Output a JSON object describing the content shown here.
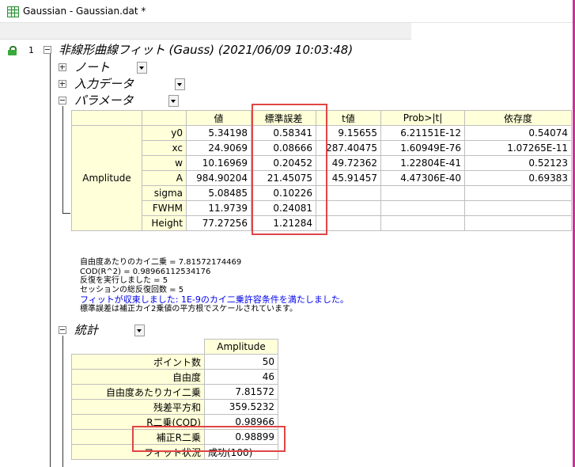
{
  "window": {
    "title": "Gaussian - Gaussian.dat *"
  },
  "report": {
    "row_number": "1",
    "title": "非線形曲線フィット (Gauss) (2021/06/09 10:03:48)",
    "sections": {
      "notes": "ノート",
      "input_data": "入力データ",
      "parameters": "パラメータ",
      "statistics": "統計"
    }
  },
  "params": {
    "headers": [
      "値",
      "標準誤差",
      "t値",
      "Prob>|t|",
      "依存度"
    ],
    "group_label": "Amplitude",
    "rows": [
      {
        "name": "y0",
        "value": "5.34198",
        "error": "0.58341",
        "t": "9.15655",
        "prob": "6.21151E-12",
        "dep": "0.54074"
      },
      {
        "name": "xc",
        "value": "24.9069",
        "error": "0.08666",
        "t": "287.40475",
        "prob": "1.60949E-76",
        "dep": "1.07265E-11"
      },
      {
        "name": "w",
        "value": "10.16969",
        "error": "0.20452",
        "t": "49.72362",
        "prob": "1.22804E-41",
        "dep": "0.52123"
      },
      {
        "name": "A",
        "value": "984.90204",
        "error": "21.45075",
        "t": "45.91457",
        "prob": "4.47306E-40",
        "dep": "0.69383"
      },
      {
        "name": "sigma",
        "value": "5.08485",
        "error": "0.10226",
        "t": "",
        "prob": "",
        "dep": ""
      },
      {
        "name": "FWHM",
        "value": "11.9739",
        "error": "0.24081",
        "t": "",
        "prob": "",
        "dep": ""
      },
      {
        "name": "Height",
        "value": "77.27256",
        "error": "1.21284",
        "t": "",
        "prob": "",
        "dep": ""
      }
    ]
  },
  "notes": {
    "lines": [
      "自由度あたりのカイ二乗 = 7.81572174469",
      "COD(R^2) = 0.98966112534176",
      "反復を実行しました = 5",
      "セッションの総反復回数 = 5"
    ],
    "converged": "フィットが収束しました: 1E-9のカイ二乗許容条件を満たしました。",
    "scale_note": "標準誤差は補正カイ2乗値の平方根でスケールされています。"
  },
  "stats": {
    "header": "Amplitude",
    "rows": [
      {
        "label": "ポイント数",
        "value": "50"
      },
      {
        "label": "自由度",
        "value": "46"
      },
      {
        "label": "自由度あたりカイ二乗",
        "value": "7.81572"
      },
      {
        "label": "残差平方和",
        "value": "359.5232"
      },
      {
        "label": "R二乗(COD)",
        "value": "0.98966"
      },
      {
        "label": "補正R二乗",
        "value": "0.98899"
      },
      {
        "label": "フィット状況",
        "value": "成功(100)"
      }
    ]
  },
  "colors": {
    "header_fill": "#ffffd9",
    "highlight": "#e04545",
    "converged_text": "#0000ee"
  },
  "icons": [
    "lock-icon",
    "expander-icon",
    "dropdown-arrow-icon",
    "app-icon"
  ]
}
